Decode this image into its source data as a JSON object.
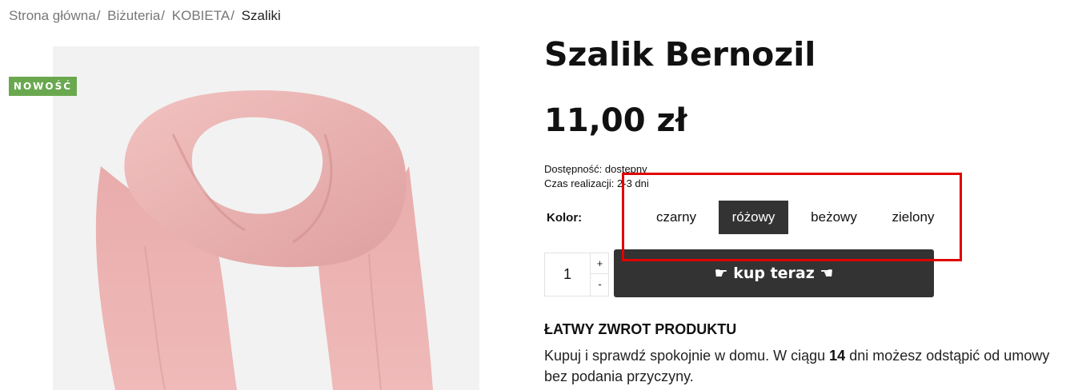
{
  "breadcrumb": {
    "items": [
      "Strona główna",
      "Biżuteria",
      "KOBIETA"
    ],
    "separator": "/",
    "current": "Szaliki"
  },
  "badge": {
    "label": "NOWOŚĆ",
    "color": "#6aa84f"
  },
  "product": {
    "image_icon": "pink-scarf-photo",
    "title": "Szalik Bernozil",
    "price": "11,00 zł",
    "availability": "Dostępność: dostępny",
    "lead_time": "Czas realizacji: 2-3 dni"
  },
  "color_selector": {
    "label": "Kolor:",
    "options": [
      "czarny",
      "różowy",
      "beżowy",
      "zielony"
    ],
    "selected": "różowy",
    "selected_bg": "#333333"
  },
  "quantity": {
    "value": "1",
    "plus": "+",
    "minus": "-"
  },
  "buy_button": {
    "label": "☛ kup teraz ☚"
  },
  "returns": {
    "title": "ŁATWY ZWROT PRODUKTU",
    "text_before": "Kupuj i sprawdź spokojnie w domu. W ciągu ",
    "days": "14",
    "text_after": " dni możesz odstąpić od umowy bez podania przyczyny."
  },
  "highlight_color": "#e00000"
}
